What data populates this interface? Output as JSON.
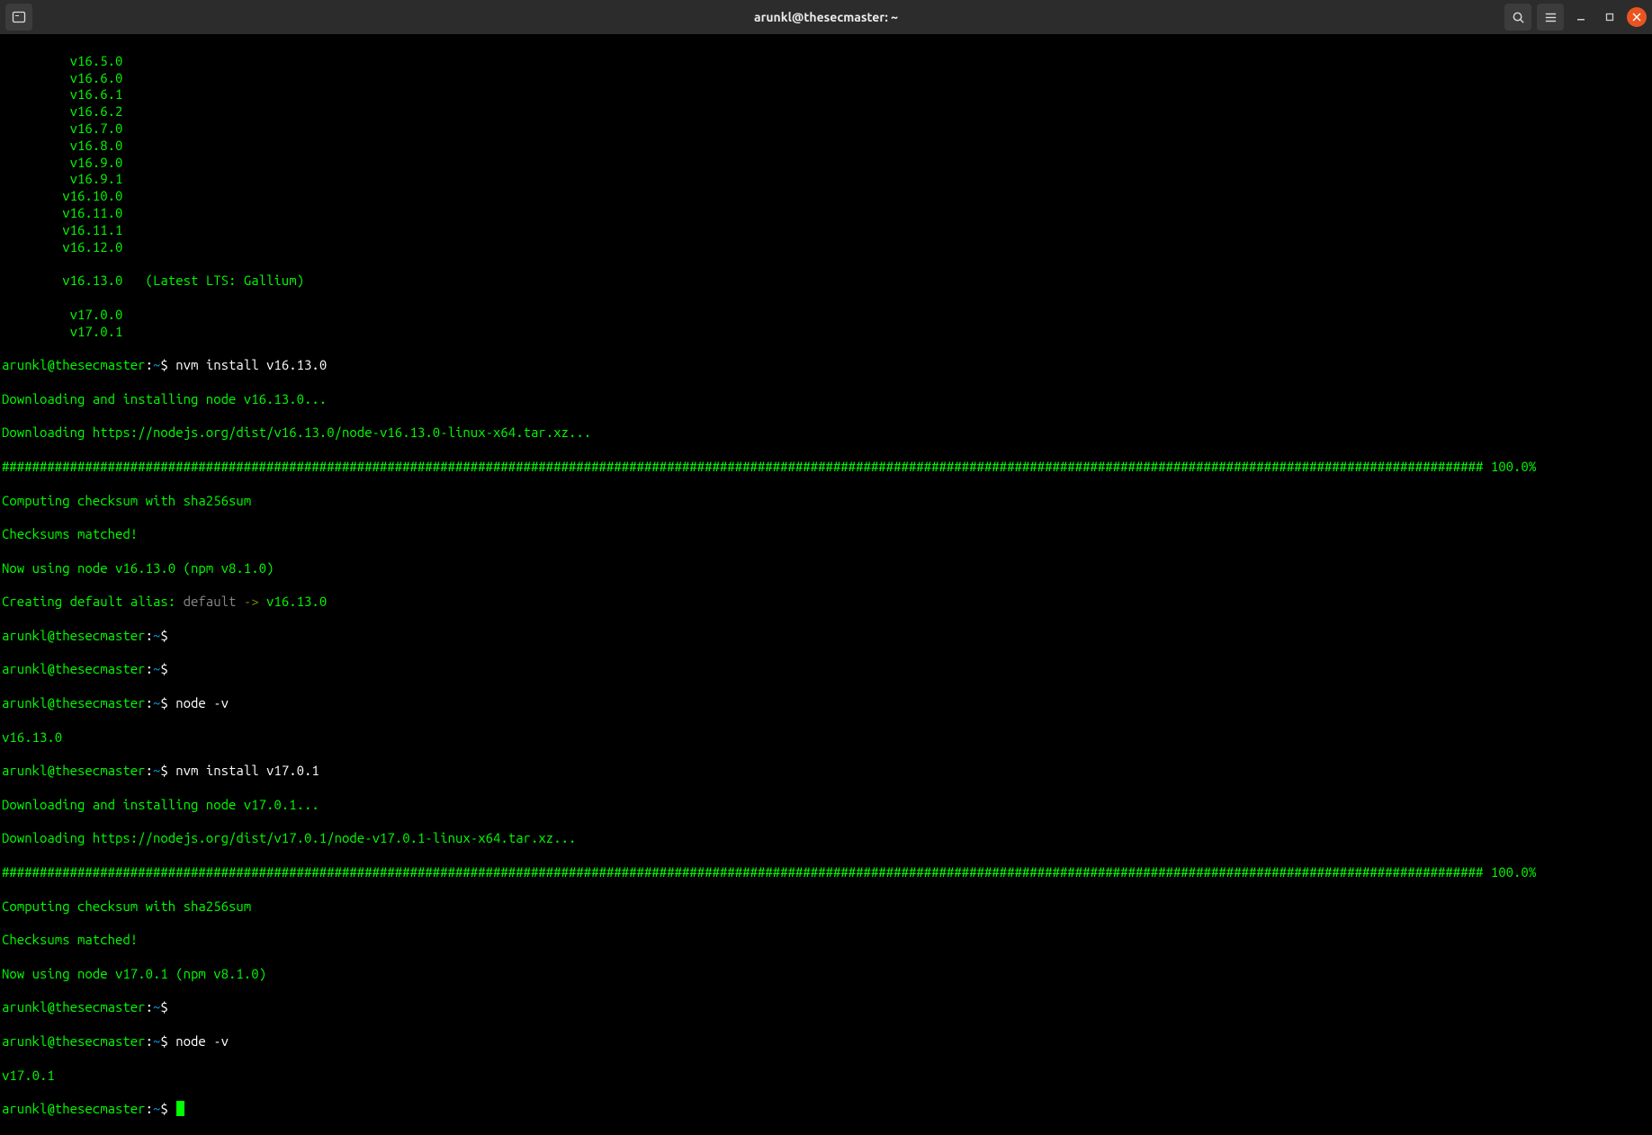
{
  "titlebar": {
    "title": "arunkl@thesecmaster: ~"
  },
  "versions": [
    "v16.5.0",
    "v16.6.0",
    "v16.6.1",
    "v16.6.2",
    "v16.7.0",
    "v16.8.0",
    "v16.9.0",
    "v16.9.1",
    "v16.10.0",
    "v16.11.0",
    "v16.11.1",
    "v16.12.0"
  ],
  "lts_version": "v16.13.0",
  "lts_label": "(Latest LTS: Gallium)",
  "post_lts_versions": [
    "v17.0.0",
    "v17.0.1"
  ],
  "prompt": {
    "user_host": "arunkl@thesecmaster",
    "sep": ":",
    "path": "~",
    "dollar": "$"
  },
  "cmd1": "nvm install v16.13.0",
  "out1_l1": "Downloading and installing node v16.13.0...",
  "out1_l2": "Downloading https://nodejs.org/dist/v16.13.0/node-v16.13.0-linux-x64.tar.xz...",
  "progress_suffix": " 100.0%",
  "out1_l3": "Computing checksum with sha256sum",
  "out1_l4": "Checksums matched!",
  "out1_l5": "Now using node v16.13.0 (npm v8.1.0)",
  "alias_prefix": "Creating default alias: ",
  "alias_name": "default",
  "alias_arrow": " -> ",
  "alias_target": "v16.13.0",
  "cmd_empty": "",
  "cmd2": "node -v",
  "out2": "v16.13.0",
  "cmd3": "nvm install v17.0.1",
  "out3_l1": "Downloading and installing node v17.0.1...",
  "out3_l2": "Downloading https://nodejs.org/dist/v17.0.1/node-v17.0.1-linux-x64.tar.xz...",
  "out3_l3": "Computing checksum with sha256sum",
  "out3_l4": "Checksums matched!",
  "out3_l5": "Now using node v17.0.1 (npm v8.1.0)",
  "cmd4": "node -v",
  "out4": "v17.0.1"
}
